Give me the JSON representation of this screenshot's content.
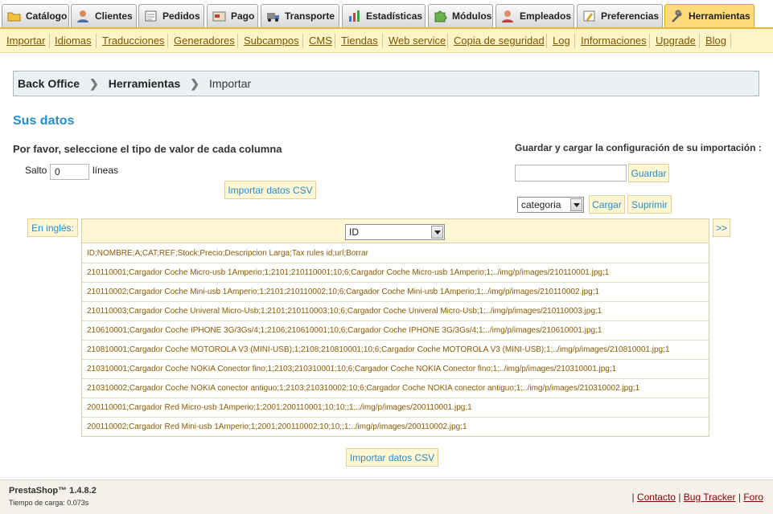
{
  "tabs": [
    {
      "label": "Catálogo",
      "icon": "folder-icon"
    },
    {
      "label": "Clientes",
      "icon": "person-icon"
    },
    {
      "label": "Pedidos",
      "icon": "order-icon"
    },
    {
      "label": "Pago",
      "icon": "payment-icon"
    },
    {
      "label": "Transporte",
      "icon": "truck-icon"
    },
    {
      "label": "Estadísticas",
      "icon": "chart-icon"
    },
    {
      "label": "Módulos",
      "icon": "puzzle-icon"
    },
    {
      "label": "Empleados",
      "icon": "employee-icon"
    },
    {
      "label": "Preferencias",
      "icon": "preferences-icon"
    },
    {
      "label": "Herramientas",
      "icon": "wrench-icon",
      "active": true
    }
  ],
  "subtabs": [
    "Importar",
    "Idiomas",
    "Traducciones",
    "Generadores",
    "Subcampos",
    "CMS",
    "Tiendas",
    "Web service",
    "Copia de seguridad",
    "Log",
    "Informaciones",
    "Upgrade",
    "Blog"
  ],
  "breadcrumb": {
    "first": "Back Office",
    "second": "Herramientas",
    "third": "Importar"
  },
  "section_title": "Sus datos",
  "instructions": "Por favor, seleccione el tipo de valor de cada columna",
  "skip": {
    "label": "Salto",
    "value": "0",
    "suffix": "líneas"
  },
  "import_button": "Importar datos CSV",
  "config": {
    "heading": "Guardar y cargar la configuración de su importación :",
    "input_value": "",
    "save_button": "Guardar",
    "select_value": "categoria",
    "load_button": "Cargar",
    "delete_button": "Suprimir"
  },
  "table": {
    "left_label": "En inglés:",
    "next_button": ">>",
    "column_select": "ID",
    "rows": [
      "ID;NOMBRE;A;CAT;REF;Stock;Precio;Descripcion Larga;Tax rules id;url;Borrar",
      "210110001;Cargador Coche Micro-usb 1Amperio;1;2101;210110001;10;6;Cargador Coche Micro-usb 1Amperio;1;../img/p/images/210110001.jpg;1",
      "210110002;Cargador Coche Mini-usb 1Amperio;1;2101;210110002;10;6;Cargador Coche Mini-usb 1Amperio;1;../img/p/images/210110002.jpg;1",
      "210110003;Cargador Coche Univeral Micro-Usb;1;2101;210110003;10;6;Cargador Coche Univeral Micro-Usb;1;../img/p/images/210110003.jpg;1",
      "210610001;Cargador Coche IPHONE 3G/3Gs/4;1;2106;210610001;10;6;Cargador Coche IPHONE 3G/3Gs/4;1;../img/p/images/210610001.jpg;1",
      "210810001;Cargador Coche MOTOROLA V3 (MINI-USB);1;2108;210810001;10;6;Cargador Coche MOTOROLA V3 (MINI-USB);1;../img/p/images/210810001.jpg;1",
      "210310001;Cargador Coche NOKIA Conector fino;1;2103;210310001;10;6;Cargador Coche NOKIA Conector fino;1;../img/p/images/210310001.jpg;1",
      "210310002;Cargador Coche NOKIA conector antiguo;1;2103;210310002;10;6;Cargador Coche NOKIA conector antiguo;1;../img/p/images/210310002.jpg;1",
      "200110001;Cargador Red Micro-usb 1Amperio;1;2001;200110001;10;10;;1;../img/p/images/200110001.jpg;1",
      "200110002;Cargador Red Mini-usb 1Amperio;1;2001;200110002;10;10;;1;../img/p/images/200110002.jpg;1"
    ]
  },
  "footer": {
    "brand": "PrestaShop™ 1.4.8.2",
    "load_time": "Tiempo de carga: 0.073s",
    "sep": "|",
    "links": [
      "Contacto",
      "Bug Tracker",
      "Foro"
    ]
  }
}
